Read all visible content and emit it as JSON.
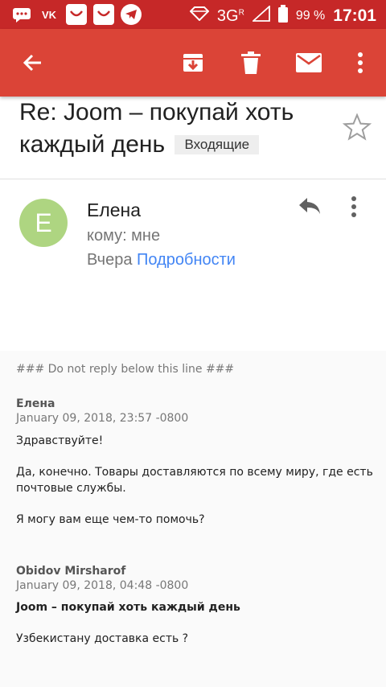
{
  "status_bar": {
    "icons": [
      "chat-icon",
      "vk-icon",
      "joom-icon",
      "joom-icon",
      "telegram-icon"
    ],
    "vk_text": "VK",
    "network": "3G",
    "network_sup": "R",
    "battery": "99 %",
    "time": "17:01"
  },
  "app_bar": {
    "icons": [
      "back-arrow-icon",
      "archive-icon",
      "delete-icon",
      "mark-unread-icon",
      "overflow-menu-icon"
    ]
  },
  "message": {
    "subject": "Re: Joom – покупай хоть каждый день",
    "label": "Входящие",
    "avatar_letter": "E",
    "sender": "Елена",
    "recipient": "кому: мне",
    "date": "Вчера",
    "details_link": "Подробности"
  },
  "email_body": {
    "separator": "### Do not reply below this line ###",
    "reply_author": "Елена",
    "reply_date": "January 09, 2018, 23:57 -0800",
    "reply_greeting": "Здравствуйте!",
    "reply_line1": "Да, конечно. Товары доставляются по всему миру, где есть",
    "reply_line2": "почтовые службы.",
    "reply_question": "Я могу вам еще чем-то помочь?",
    "orig_author": "Obidov Mirsharof",
    "orig_date": "January 09, 2018, 04:48 -0800",
    "orig_subject": "Joom – покупай хоть каждый день",
    "orig_text": "Узбекистану доставка есть ?"
  },
  "colors": {
    "status_bar": "#c62828",
    "app_bar": "#db4437",
    "avatar": "#aed581",
    "link": "#4285f4"
  }
}
